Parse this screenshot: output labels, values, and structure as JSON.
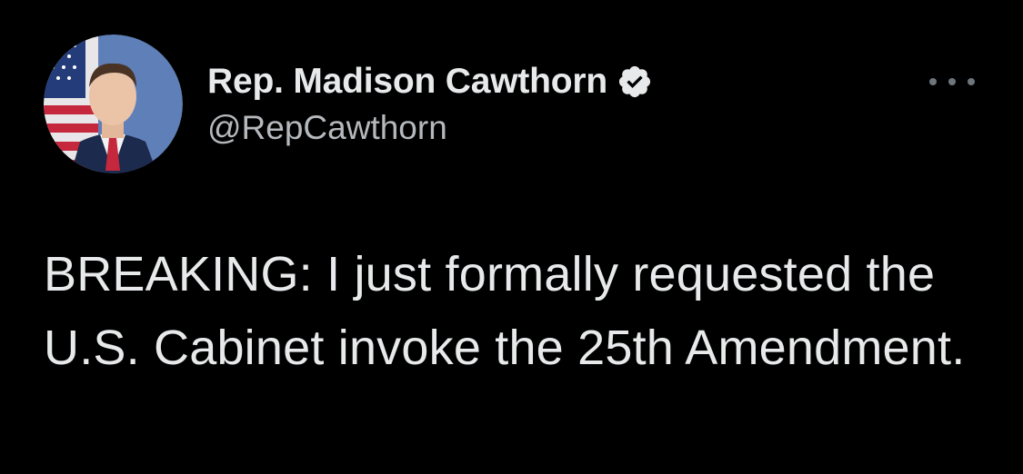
{
  "tweet": {
    "author": {
      "display_name": "Rep. Madison Cawthorn",
      "handle": "@RepCawthorn",
      "verified_icon": "verified-badge-icon",
      "avatar": "profile-photo"
    },
    "more_icon": "more-options-icon",
    "text": "BREAKING: I just formally requested the U.S. Cabinet invoke the 25th Amendment."
  },
  "colors": {
    "background": "#000000",
    "primary_text": "#e7e9ea",
    "secondary_text": "#b5b9bd",
    "muted_icon": "#6e767d"
  }
}
